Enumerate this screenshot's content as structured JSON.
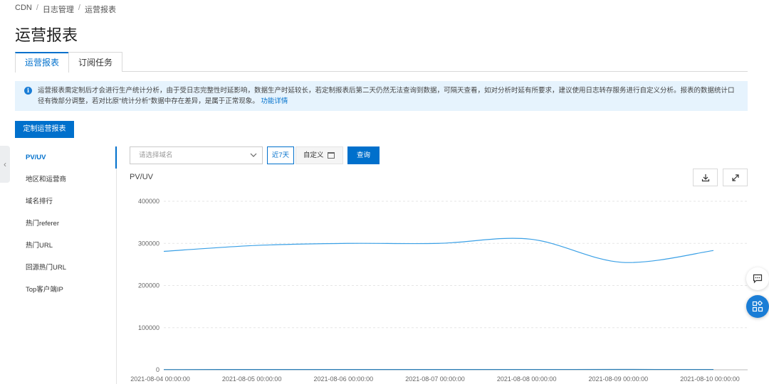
{
  "breadcrumb": {
    "items": [
      "CDN",
      "日志管理",
      "运营报表"
    ],
    "separator": "/"
  },
  "page": {
    "title": "运营报表"
  },
  "tabs": [
    {
      "label": "运营报表",
      "active": true
    },
    {
      "label": "订阅任务",
      "active": false
    }
  ],
  "notice": {
    "icon": "info-icon",
    "text": "运营报表需定制后才会进行生产统计分析，由于受日志完整性时延影响，数据生产时延较长，若定制报表后第二天仍然无法查询到数据，可隔天查看，如对分析时延有所要求，建议使用日志转存服务进行自定义分析。报表的数据统计口径有微部分调整，若对比原\"统计分析\"数据中存在差异，是属于正常现象。",
    "link": "功能详情"
  },
  "actions": {
    "customize_button": "定制运营报表"
  },
  "side_menu": {
    "items": [
      {
        "label": "PV/UV",
        "active": true
      },
      {
        "label": "地区和运营商",
        "active": false
      },
      {
        "label": "域名排行",
        "active": false
      },
      {
        "label": "热门referer",
        "active": false
      },
      {
        "label": "热门URL",
        "active": false
      },
      {
        "label": "回源热门URL",
        "active": false
      },
      {
        "label": "Top客户端IP",
        "active": false
      }
    ]
  },
  "filters": {
    "domain_select": {
      "placeholder": "请选择域名",
      "value": ""
    },
    "recent_button": "近7天",
    "custom_button": "自定义",
    "query_button": "查询"
  },
  "chart_header": {
    "title": "PV/UV",
    "download_icon": "download-icon",
    "fullscreen_icon": "expand-icon"
  },
  "colors": {
    "accent": "#0070cc",
    "pv_line": "#3aa0e6",
    "uv_line": "#2a7fb8",
    "notice_bg": "#e6f3fd"
  },
  "chart_data": {
    "type": "line",
    "title": "PV/UV",
    "x": [
      "2021-08-04 00:00:00",
      "2021-08-05 00:00:00",
      "2021-08-06 00:00:00",
      "2021-08-07 00:00:00",
      "2021-08-08 00:00:00",
      "2021-08-09 00:00:00",
      "2021-08-10 00:00:00"
    ],
    "series": [
      {
        "values": [
          281000,
          295000,
          300000,
          300000,
          310000,
          255000,
          283000
        ]
      },
      {
        "values": [
          500,
          600,
          600,
          600,
          700,
          800,
          700
        ]
      }
    ],
    "ylim": [
      0,
      400000
    ],
    "yticks": [
      0,
      100000,
      200000,
      300000,
      400000
    ],
    "grid": true,
    "smooth": true
  }
}
